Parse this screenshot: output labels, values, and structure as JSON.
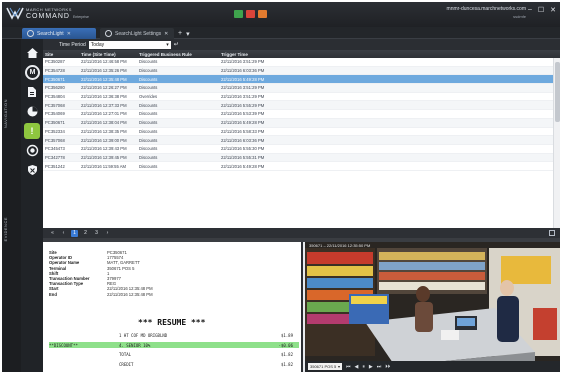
{
  "app": {
    "brand_line1": "MARCH NETWORKS",
    "brand_line2": "COMMAND",
    "brand_sub": "Enterprise",
    "host": "mnmr-duncesa.marchnetworks.com",
    "user": "ssdmfe",
    "window_controls": [
      "–",
      "☐",
      "✕"
    ],
    "toolbar_icon_colors": [
      "#3fa34d",
      "#d9443a",
      "#e27b2f"
    ]
  },
  "tabs": [
    {
      "label": "SearchLight",
      "active": true
    },
    {
      "label": "SearchLight Settings",
      "active": false
    }
  ],
  "leftnav": {
    "label_navigation": "NAVIGATION",
    "label_evidence": "EVIDENCE",
    "icons": [
      "home-icon",
      "m-icon",
      "document-icon",
      "pie-chart-icon",
      "alert-icon",
      "target-icon",
      "shield-icon"
    ]
  },
  "filter": {
    "label": "Time Period",
    "value": "Today"
  },
  "columns": [
    "Site",
    "Time (Site Time)",
    "Triggered Business Rule",
    "Trigger Time"
  ],
  "rows": [
    {
      "site": "PC350287",
      "time": "22/11/2016 12:46:58 PM",
      "rule": "Discounts",
      "trigger": "22/11/2016 3:51:29 PM"
    },
    {
      "site": "PC354728",
      "time": "22/11/2016 12:35:26 PM",
      "rule": "Discounts",
      "trigger": "22/11/2016 6:03:36 PM"
    },
    {
      "site": "PC350671",
      "time": "22/11/2016 12:35:48 PM",
      "rule": "Discounts",
      "trigger": "22/11/2016 5:49:28 PM",
      "selected": true
    },
    {
      "site": "PC356280",
      "time": "22/11/2016 12:26:27 PM",
      "rule": "Discounts",
      "trigger": "22/11/2016 3:51:29 PM"
    },
    {
      "site": "PC354804",
      "time": "22/11/2016 12:36:38 PM",
      "rule": "Overrides",
      "trigger": "22/11/2016 3:51:29 PM"
    },
    {
      "site": "PC357068",
      "time": "22/11/2016 12:37:33 PM",
      "rule": "Discounts",
      "trigger": "22/11/2016 5:55:29 PM"
    },
    {
      "site": "PC354069",
      "time": "22/11/2016 12:27:01 PM",
      "rule": "Discounts",
      "trigger": "22/11/2016 5:53:39 PM"
    },
    {
      "site": "PC350671",
      "time": "22/11/2016 12:38:04 PM",
      "rule": "Discounts",
      "trigger": "22/11/2016 5:49:28 PM"
    },
    {
      "site": "PC352334",
      "time": "22/11/2016 12:38:35 PM",
      "rule": "Discounts",
      "trigger": "22/11/2016 5:58:33 PM"
    },
    {
      "site": "PC357068",
      "time": "22/11/2016 12:39:00 PM",
      "rule": "Discounts",
      "trigger": "22/11/2016 6:03:36 PM"
    },
    {
      "site": "PC345473",
      "time": "22/11/2016 12:39:43 PM",
      "rule": "Discounts",
      "trigger": "22/11/2016 5:55:30 PM"
    },
    {
      "site": "PC342778",
      "time": "22/11/2016 12:39:45 PM",
      "rule": "Discounts",
      "trigger": "22/11/2016 5:55:31 PM"
    },
    {
      "site": "PC351242",
      "time": "22/11/2016 11:59:55 AM",
      "rule": "Discounts",
      "trigger": "22/11/2016 5:49:28 PM"
    }
  ],
  "pager": {
    "prev": "«",
    "prev1": "‹",
    "pages": [
      "1",
      "2",
      "3"
    ],
    "current": "1",
    "next": "›"
  },
  "receipt": {
    "fields": [
      {
        "k": "Site",
        "v": "PC350671"
      },
      {
        "k": "Operator ID",
        "v": "1775574"
      },
      {
        "k": "Operator Name",
        "v": "MATT, GARRETT"
      },
      {
        "k": "Terminal",
        "v": "350671 POS 5"
      },
      {
        "k": "Shift",
        "v": "1"
      },
      {
        "k": "Transaction Number",
        "v": "379977"
      },
      {
        "k": "Transaction Type",
        "v": "REG"
      },
      {
        "k": "Start",
        "v": "22/11/2016 12:35:48 PM"
      },
      {
        "k": "End",
        "v": "22/11/2016 12:35:48 PM"
      }
    ],
    "resume": "*** RESUME ***",
    "lines": [
      {
        "left": "",
        "mid": "1 HT COF MD ORIGBLND",
        "amt": "$1.89",
        "green": false
      },
      {
        "left": "**DISCOUNT**",
        "mid": "4. SENIOR 10%",
        "amt": "-$0.06",
        "green": true
      },
      {
        "left": "",
        "mid": "TOTAL",
        "amt": "$1.82",
        "green": false
      },
      {
        "left": "",
        "mid": "CREDIT",
        "amt": "$1.82",
        "green": false
      }
    ]
  },
  "video": {
    "title": "350671 – 22/11/2016 12:35:50 PM",
    "camera": "350671 POS 5",
    "controls": [
      "⏮",
      "◀",
      "⏸",
      "▶",
      "⏭",
      "⏵⏵"
    ]
  }
}
